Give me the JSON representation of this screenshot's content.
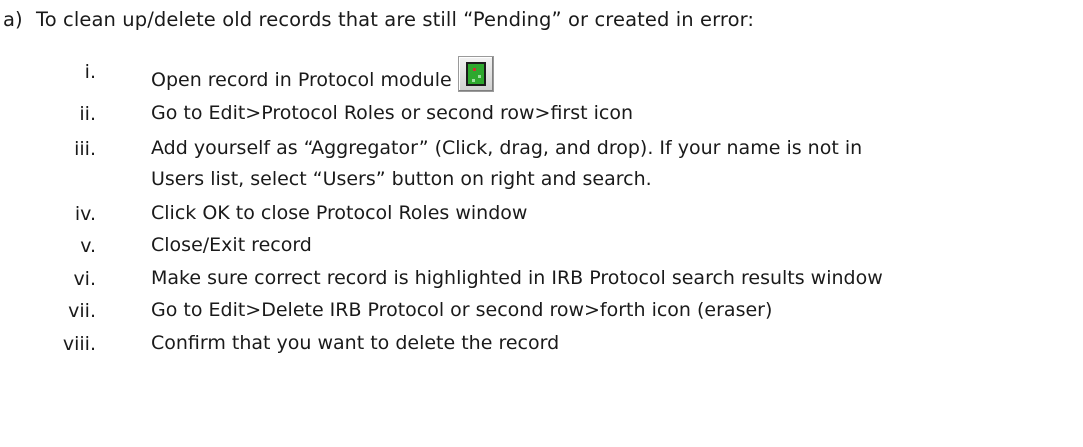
{
  "heading": {
    "marker": "a)",
    "text": "To clean up/delete old records that are still “Pending” or created in error:"
  },
  "steps": [
    {
      "num": "i.",
      "text": "Open record in Protocol module",
      "icon": "protocol-module-icon"
    },
    {
      "num": "ii.",
      "text": "Go to Edit>Protocol Roles or second row>first icon"
    },
    {
      "num": "iii.",
      "lines": [
        "Add yourself as “Aggregator” (Click, drag, and drop).  If your name is not in",
        "Users list, select “Users” button on right and search."
      ]
    },
    {
      "num": "iv.",
      "text": "Click OK to close Protocol Roles window"
    },
    {
      "num": "v.",
      "text": "Close/Exit record"
    },
    {
      "num": "vi.",
      "text": "Make sure correct record is highlighted in IRB Protocol search results window"
    },
    {
      "num": "vii.",
      "text": "Go to Edit>Delete IRB Protocol or second row>forth icon (eraser)"
    },
    {
      "num": "viii.",
      "text": "Confirm that you want to delete the record"
    }
  ]
}
